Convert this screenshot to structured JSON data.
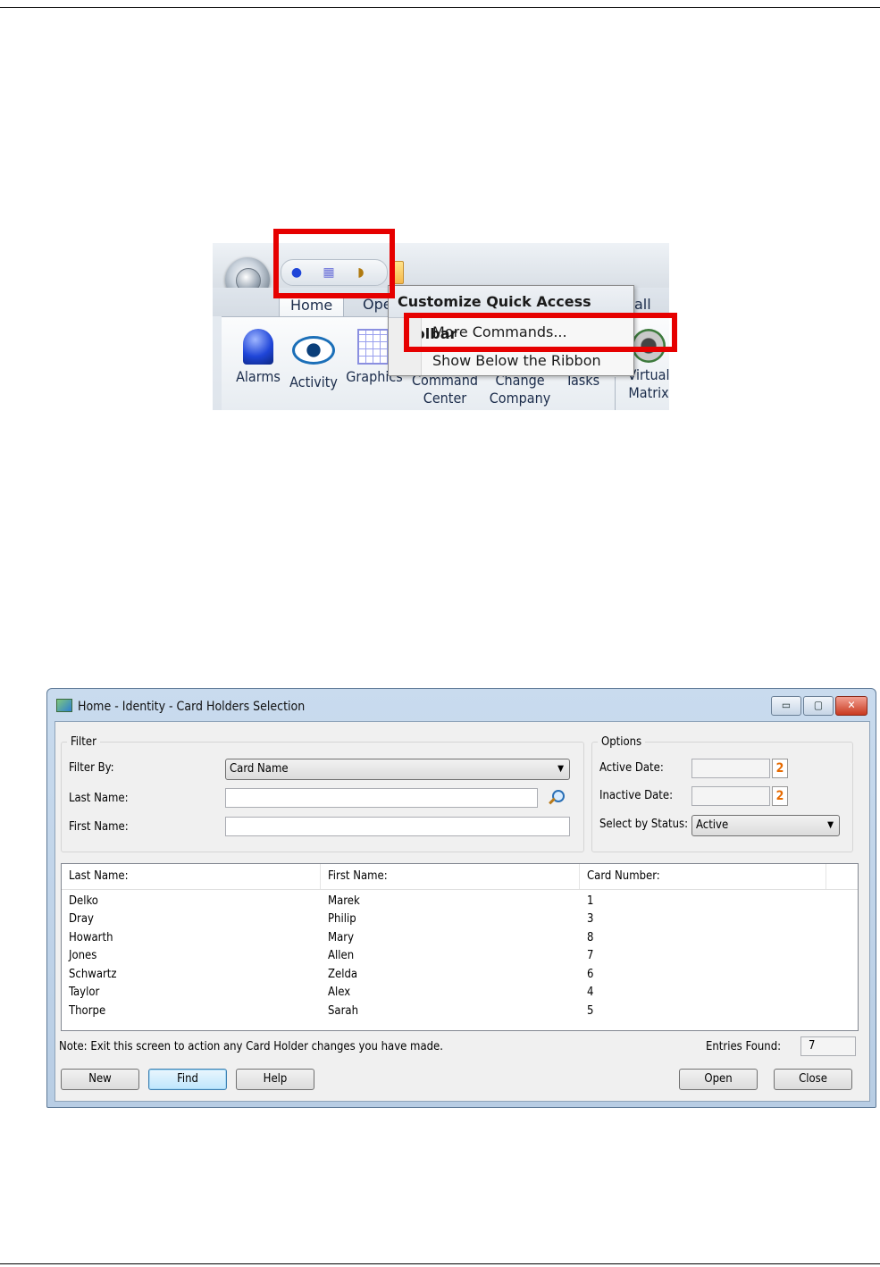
{
  "ribbon": {
    "tabs": [
      "Home",
      "Ope",
      "all"
    ],
    "commands": [
      {
        "label": "Alarms",
        "icon": "alarm-icon"
      },
      {
        "label": "Activity",
        "icon": "eye-icon"
      },
      {
        "label": "Graphics",
        "icon": "graphics-icon"
      },
      {
        "label": "Command Center",
        "icon": ""
      },
      {
        "label": "Change Company",
        "icon": ""
      },
      {
        "label": "Tasks",
        "icon": ""
      },
      {
        "label": "Virtual Matrix",
        "icon": "virtual-matrix-icon"
      }
    ],
    "quick_access_icons": [
      "alarm-icon",
      "grid-icon",
      "camera-icon"
    ],
    "menu": {
      "title": "Customize Quick Access Toolbar",
      "items": [
        "More Commands...",
        "Show Below the Ribbon"
      ]
    },
    "callout_color": "#e60000"
  },
  "dialog": {
    "title": "Home - Identity - Card Holders Selection",
    "window_buttons": [
      "minimize",
      "maximize",
      "close"
    ],
    "filter": {
      "legend": "Filter",
      "filter_by_label": "Filter By:",
      "filter_by_value": "Card Name",
      "last_name_label": "Last Name:",
      "last_name_value": "",
      "first_name_label": "First Name:",
      "first_name_value": ""
    },
    "options": {
      "legend": "Options",
      "active_date_label": "Active Date:",
      "active_date_value": "",
      "inactive_date_label": "Inactive Date:",
      "inactive_date_value": "",
      "status_label": "Select by Status:",
      "status_value": "Active",
      "calendar_glyph": "2"
    },
    "list": {
      "columns": [
        "Last Name:",
        "First Name:",
        "Card Number:"
      ],
      "rows": [
        [
          "Delko",
          "Marek",
          "1"
        ],
        [
          "Dray",
          "Philip",
          "3"
        ],
        [
          "Howarth",
          "Mary",
          "8"
        ],
        [
          "Jones",
          "Allen",
          "7"
        ],
        [
          "Schwartz",
          "Zelda",
          "6"
        ],
        [
          "Taylor",
          "Alex",
          "4"
        ],
        [
          "Thorpe",
          "Sarah",
          "5"
        ]
      ]
    },
    "note": "Note: Exit this screen to action any Card Holder changes you have made.",
    "entries_found_label": "Entries Found:",
    "entries_found_value": "7",
    "buttons": {
      "new": "New",
      "find": "Find",
      "help": "Help",
      "open": "Open",
      "close": "Close"
    }
  }
}
